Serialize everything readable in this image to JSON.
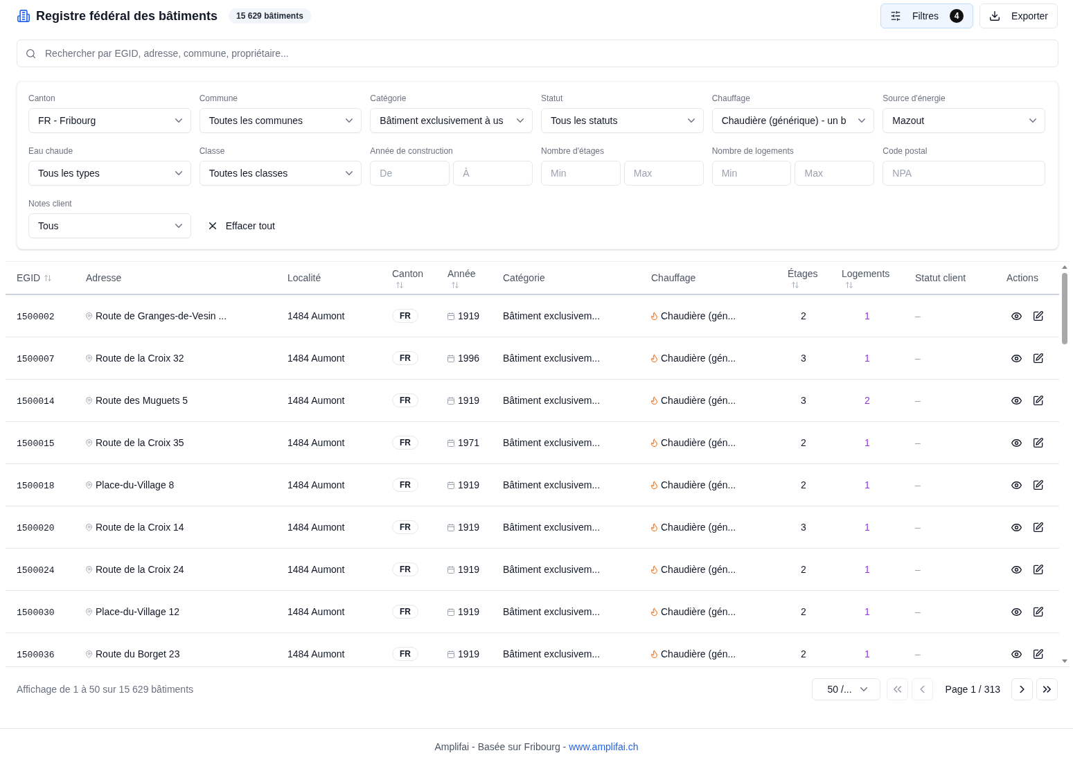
{
  "header": {
    "title": "Registre fédéral des bâtiments",
    "count_badge": "15 629 bâtiments",
    "buttons": [
      {
        "kind": "filters",
        "label": "Filtres",
        "badge": "4",
        "active": true
      },
      {
        "kind": "export",
        "label": "Exporter",
        "active": false
      }
    ]
  },
  "search": {
    "placeholder": "Rechercher par EGID, adresse, commune, propriétaire..."
  },
  "filters": {
    "fields": [
      {
        "kind": "select",
        "label": "Canton",
        "value": "FR - Fribourg"
      },
      {
        "kind": "select",
        "label": "Commune",
        "value": "Toutes les communes"
      },
      {
        "kind": "select",
        "label": "Catégorie",
        "value": "Bâtiment exclusivement à us"
      },
      {
        "kind": "select",
        "label": "Statut",
        "value": "Tous les statuts"
      },
      {
        "kind": "select",
        "label": "Chauffage",
        "value": "Chaudière (générique) - un b"
      },
      {
        "kind": "select",
        "label": "Source d'énergie",
        "value": "Mazout"
      },
      {
        "kind": "select",
        "label": "Eau chaude",
        "value": "Tous les types"
      },
      {
        "kind": "select",
        "label": "Classe",
        "value": "Toutes les classes"
      },
      {
        "kind": "range",
        "label": "Année de construction",
        "placeholders": [
          "De",
          "À"
        ]
      },
      {
        "kind": "range",
        "label": "Nombre d'étages",
        "placeholders": [
          "Min",
          "Max"
        ]
      },
      {
        "kind": "range",
        "label": "Nombre de logements",
        "placeholders": [
          "Min",
          "Max"
        ]
      },
      {
        "kind": "text",
        "label": "Code postal",
        "placeholder": "NPA"
      },
      {
        "kind": "select",
        "label": "Notes client",
        "value": "Tous"
      }
    ],
    "clear_button": "Effacer tout"
  },
  "table": {
    "columns": [
      {
        "label": "EGID",
        "sortable": true
      },
      {
        "label": "Adresse",
        "sortable": false
      },
      {
        "label": "Localité",
        "sortable": false
      },
      {
        "label": "Canton",
        "sortable": true
      },
      {
        "label": "Année",
        "sortable": true
      },
      {
        "label": "Catégorie",
        "sortable": false
      },
      {
        "label": "Chauffage",
        "sortable": false
      },
      {
        "label": "Étages",
        "sortable": true
      },
      {
        "label": "Logements",
        "sortable": true
      },
      {
        "label": "Statut client",
        "sortable": false
      },
      {
        "label": "Actions",
        "sortable": false
      }
    ],
    "rows": [
      {
        "egid": "1500002",
        "address": "Route de Granges-de-Vesin ...",
        "locality": "1484 Aumont",
        "canton": "FR",
        "year": "1919",
        "category": "Bâtiment exclusivem...",
        "heating": "Chaudière (gén...",
        "floors": "2",
        "dwellings": "1",
        "status": "–"
      },
      {
        "egid": "1500007",
        "address": "Route de la Croix 32",
        "locality": "1484 Aumont",
        "canton": "FR",
        "year": "1996",
        "category": "Bâtiment exclusivem...",
        "heating": "Chaudière (gén...",
        "floors": "3",
        "dwellings": "1",
        "status": "–"
      },
      {
        "egid": "1500014",
        "address": "Route des Muguets 5",
        "locality": "1484 Aumont",
        "canton": "FR",
        "year": "1919",
        "category": "Bâtiment exclusivem...",
        "heating": "Chaudière (gén...",
        "floors": "3",
        "dwellings": "2",
        "status": "–"
      },
      {
        "egid": "1500015",
        "address": "Route de la Croix 35",
        "locality": "1484 Aumont",
        "canton": "FR",
        "year": "1971",
        "category": "Bâtiment exclusivem...",
        "heating": "Chaudière (gén...",
        "floors": "2",
        "dwellings": "1",
        "status": "–"
      },
      {
        "egid": "1500018",
        "address": "Place-du-Village 8",
        "locality": "1484 Aumont",
        "canton": "FR",
        "year": "1919",
        "category": "Bâtiment exclusivem...",
        "heating": "Chaudière (gén...",
        "floors": "2",
        "dwellings": "1",
        "status": "–"
      },
      {
        "egid": "1500020",
        "address": "Route de la Croix 14",
        "locality": "1484 Aumont",
        "canton": "FR",
        "year": "1919",
        "category": "Bâtiment exclusivem...",
        "heating": "Chaudière (gén...",
        "floors": "3",
        "dwellings": "1",
        "status": "–"
      },
      {
        "egid": "1500024",
        "address": "Route de la Croix 24",
        "locality": "1484 Aumont",
        "canton": "FR",
        "year": "1919",
        "category": "Bâtiment exclusivem...",
        "heating": "Chaudière (gén...",
        "floors": "2",
        "dwellings": "1",
        "status": "–"
      },
      {
        "egid": "1500030",
        "address": "Place-du-Village 12",
        "locality": "1484 Aumont",
        "canton": "FR",
        "year": "1919",
        "category": "Bâtiment exclusivem...",
        "heating": "Chaudière (gén...",
        "floors": "2",
        "dwellings": "1",
        "status": "–"
      },
      {
        "egid": "1500036",
        "address": "Route du Borget 23",
        "locality": "1484 Aumont",
        "canton": "FR",
        "year": "1919",
        "category": "Bâtiment exclusivem...",
        "heating": "Chaudière (gén...",
        "floors": "2",
        "dwellings": "1",
        "status": "–"
      }
    ]
  },
  "pagination": {
    "summary": "Affichage de 1 à 50 sur 15 629 bâtiments",
    "page_size": "50 /...",
    "page_label": "Page 1 / 313",
    "buttons": [
      {
        "kind": "first",
        "disabled": true
      },
      {
        "kind": "prev",
        "disabled": true
      },
      {
        "kind": "next",
        "disabled": false
      },
      {
        "kind": "last",
        "disabled": false
      }
    ]
  },
  "footer": {
    "text": "Amplifai - Basée sur Fribourg - ",
    "link": "www.amplifai.ch"
  }
}
